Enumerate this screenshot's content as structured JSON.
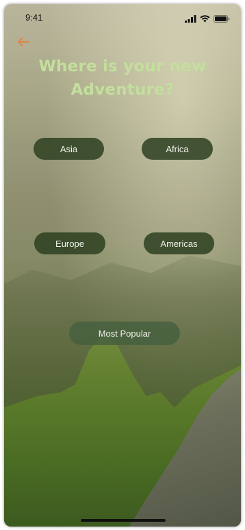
{
  "status_bar": {
    "time": "9:41",
    "icons": [
      "signal-icon",
      "wifi-icon",
      "battery-icon"
    ]
  },
  "header": {
    "back_icon": "back-arrow-icon",
    "title_line1": "Where is your new",
    "title_line2": "Adventure?"
  },
  "regions": [
    {
      "label": "Asia"
    },
    {
      "label": "Africa"
    },
    {
      "label": "Europe"
    },
    {
      "label": "Americas"
    }
  ],
  "most_popular": {
    "label": "Most Popular"
  },
  "colors": {
    "title": "#c3df9d",
    "back_arrow": "#d98a4a",
    "pill_bg": "#2d3f21",
    "pill_text": "#f1f1ea"
  }
}
